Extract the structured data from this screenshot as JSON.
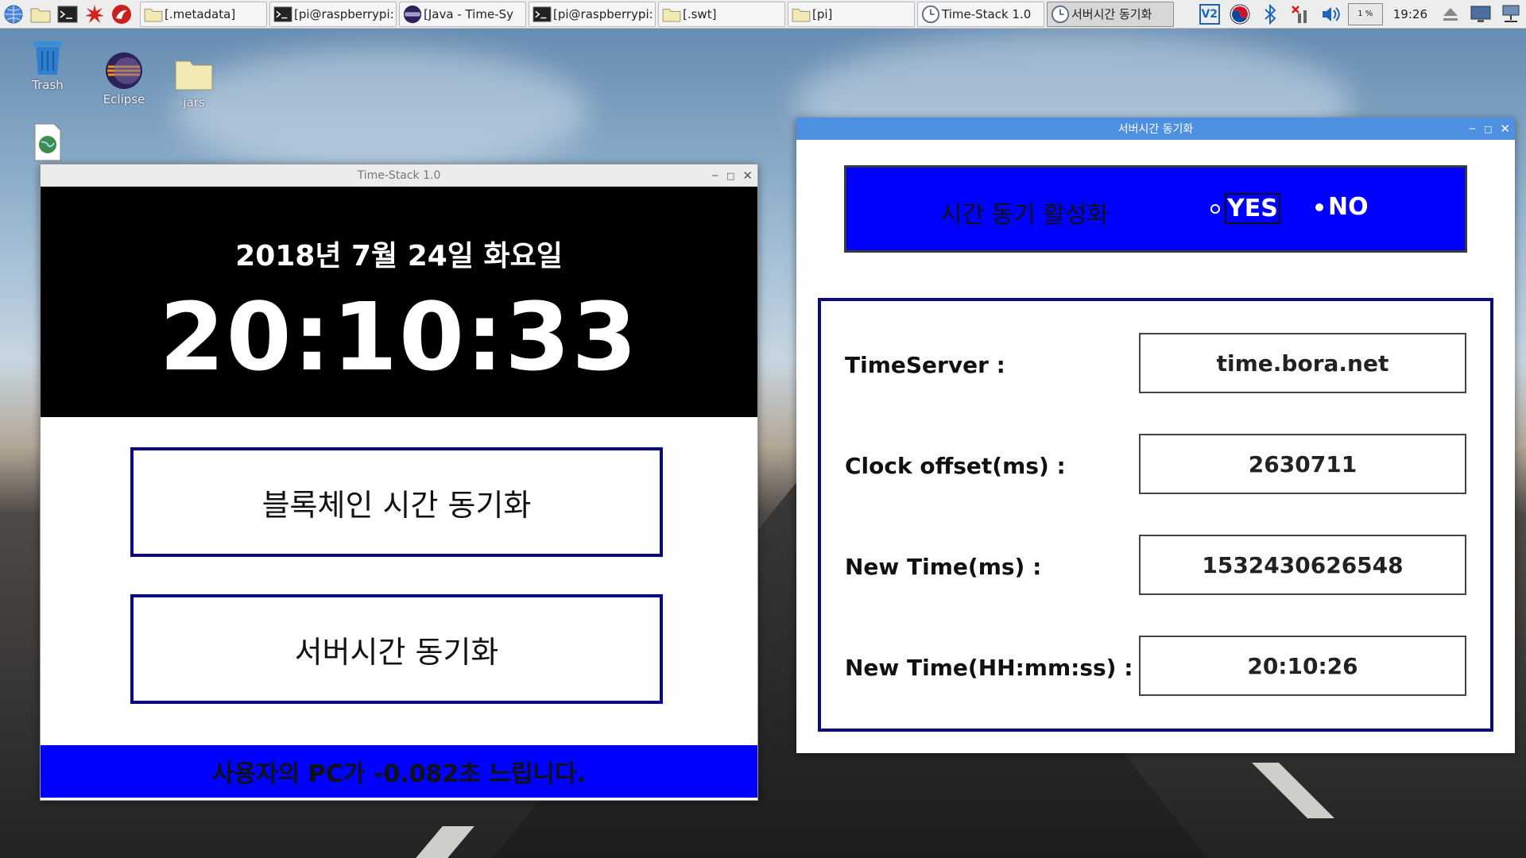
{
  "taskbar": {
    "launchers": [
      {
        "icon": "globe-icon"
      },
      {
        "icon": "folder-icon"
      },
      {
        "icon": "terminal-icon"
      },
      {
        "icon": "star-burst-icon"
      },
      {
        "icon": "wolfram-icon"
      }
    ],
    "tasks": [
      {
        "label": "[.metadata]",
        "icon": "folder-icon",
        "active": false
      },
      {
        "label": "[pi@raspberrypi:",
        "icon": "terminal-icon",
        "active": false
      },
      {
        "label": "[Java - Time-Sy",
        "icon": "eclipse-icon",
        "active": false
      },
      {
        "label": "[pi@raspberrypi:",
        "icon": "terminal-icon",
        "active": false
      },
      {
        "label": "[.swt]",
        "icon": "folder-icon",
        "active": false
      },
      {
        "label": "[pi]",
        "icon": "folder-icon",
        "active": false
      },
      {
        "label": "Time-Stack 1.0",
        "icon": "app-icon",
        "active": false
      },
      {
        "label": "서버시간 동기화",
        "icon": "app-icon",
        "active": true
      }
    ],
    "tray": {
      "cpu_label": "1 %",
      "time": "19:26"
    }
  },
  "desktop": {
    "icons": [
      {
        "label": "Trash",
        "icon": "trash-icon"
      },
      {
        "label": "Eclipse",
        "icon": "eclipse-icon"
      },
      {
        "label": "jars",
        "icon": "folder-icon"
      },
      {
        "label": "",
        "icon": "web-file-icon"
      }
    ]
  },
  "time_stack": {
    "title": "Time-Stack 1.0",
    "date": "2018년 7월 24일 화요일",
    "time": "20:10:33",
    "blockchain_button": "블록체인 시간 동기화",
    "server_button": "서버시간 동기화",
    "status": "사용자의 PC가 -0.082초 느립니다."
  },
  "server_sync": {
    "title": "서버시간 동기화",
    "toggle_label": "시간 동기 활성화",
    "yes_label": "YES",
    "no_label": "NO",
    "rows": [
      {
        "label": "TimeServer :",
        "value": "time.bora.net"
      },
      {
        "label": "Clock offset(ms) :",
        "value": "2630711"
      },
      {
        "label": "New Time(ms) :",
        "value": "1532430626548"
      },
      {
        "label": "New Time(HH:mm:ss) :",
        "value": "20:10:26"
      }
    ]
  },
  "colors": {
    "accent_blue": "#0000ff",
    "border_navy": "#0a0a80",
    "titlebar_blue": "#4d8fe0"
  }
}
